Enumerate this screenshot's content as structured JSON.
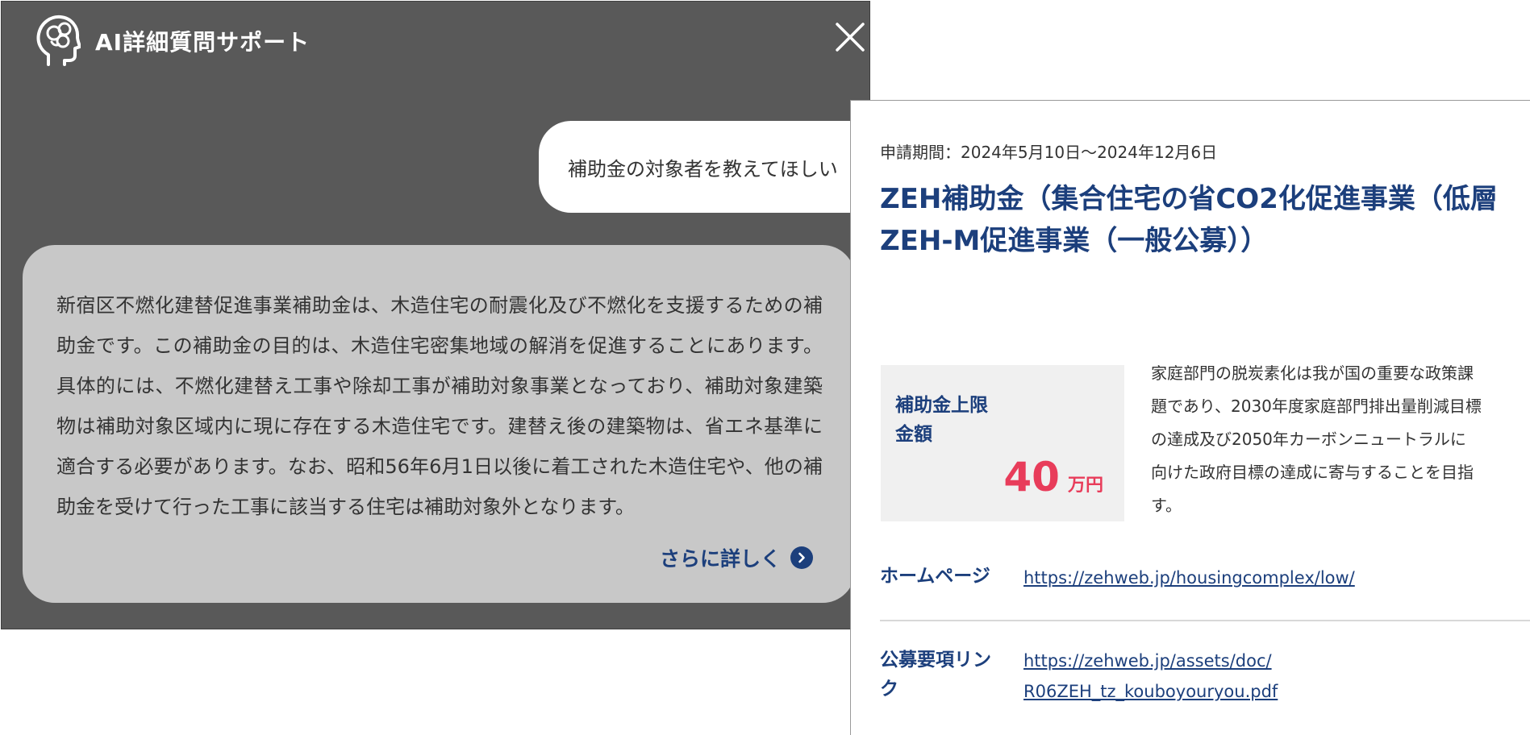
{
  "chat": {
    "title": "AI詳細質問サポート",
    "icons": {
      "header": "brain-head-icon",
      "close": "close-icon",
      "more": "chevron-right-circle-icon"
    },
    "user_message": "補助金の対象者を教えてほしい",
    "ai_response": "新宿区不燃化建替促進事業補助金は、木造住宅の耐震化及び不燃化を支援するための補助金です。この補助金の目的は、木造住宅密集地域の解消を促進することにあります。具体的には、不燃化建替え工事や除却工事が補助対象事業となっており、補助対象建築物は補助対象区域内に現に存在する木造住宅です。建替え後の建築物は、省エネ基準に適合する必要があります。なお、昭和56年6月1日以後に着工された木造住宅や、他の補助金を受けて行った工事に該当する住宅は補助対象外となります。",
    "more_link": "さらに詳しく"
  },
  "subsidy": {
    "period": "申請期間：2024年5月10日〜2024年12月6日",
    "title_line1": "ZEH補助金（集合住宅の省CO2化促進事業（低層",
    "title_line2": "ZEH-M促進事業（一般公募））",
    "limit_label_line1": "補助金上限",
    "limit_label_line2": "金額",
    "limit_value": "40",
    "limit_unit": "万円",
    "description": "家庭部門の脱炭素化は我が国の重要な政策課題であり、2030年度家庭部門排出量削減目標の達成及び2050年カーボンニュートラルに向けた政府目標の達成に寄与することを目指す。",
    "homepage_label": "ホームページ",
    "homepage_url": "https://zehweb.jp/housingcomplex/low/",
    "guideline_label_line1": "公募要項リン",
    "guideline_label_line2": "ク",
    "guideline_url_line1": "https://zehweb.jp/assets/doc/",
    "guideline_url_line2": "R06ZEH_tz_kouboyouryou.pdf"
  },
  "colors": {
    "panel_bg": "#595959",
    "ai_bubble_bg": "#c8c8c8",
    "accent_navy": "#1c3f7c",
    "amount_red": "#e83c5a",
    "limit_box_bg": "#f0f0f0"
  }
}
